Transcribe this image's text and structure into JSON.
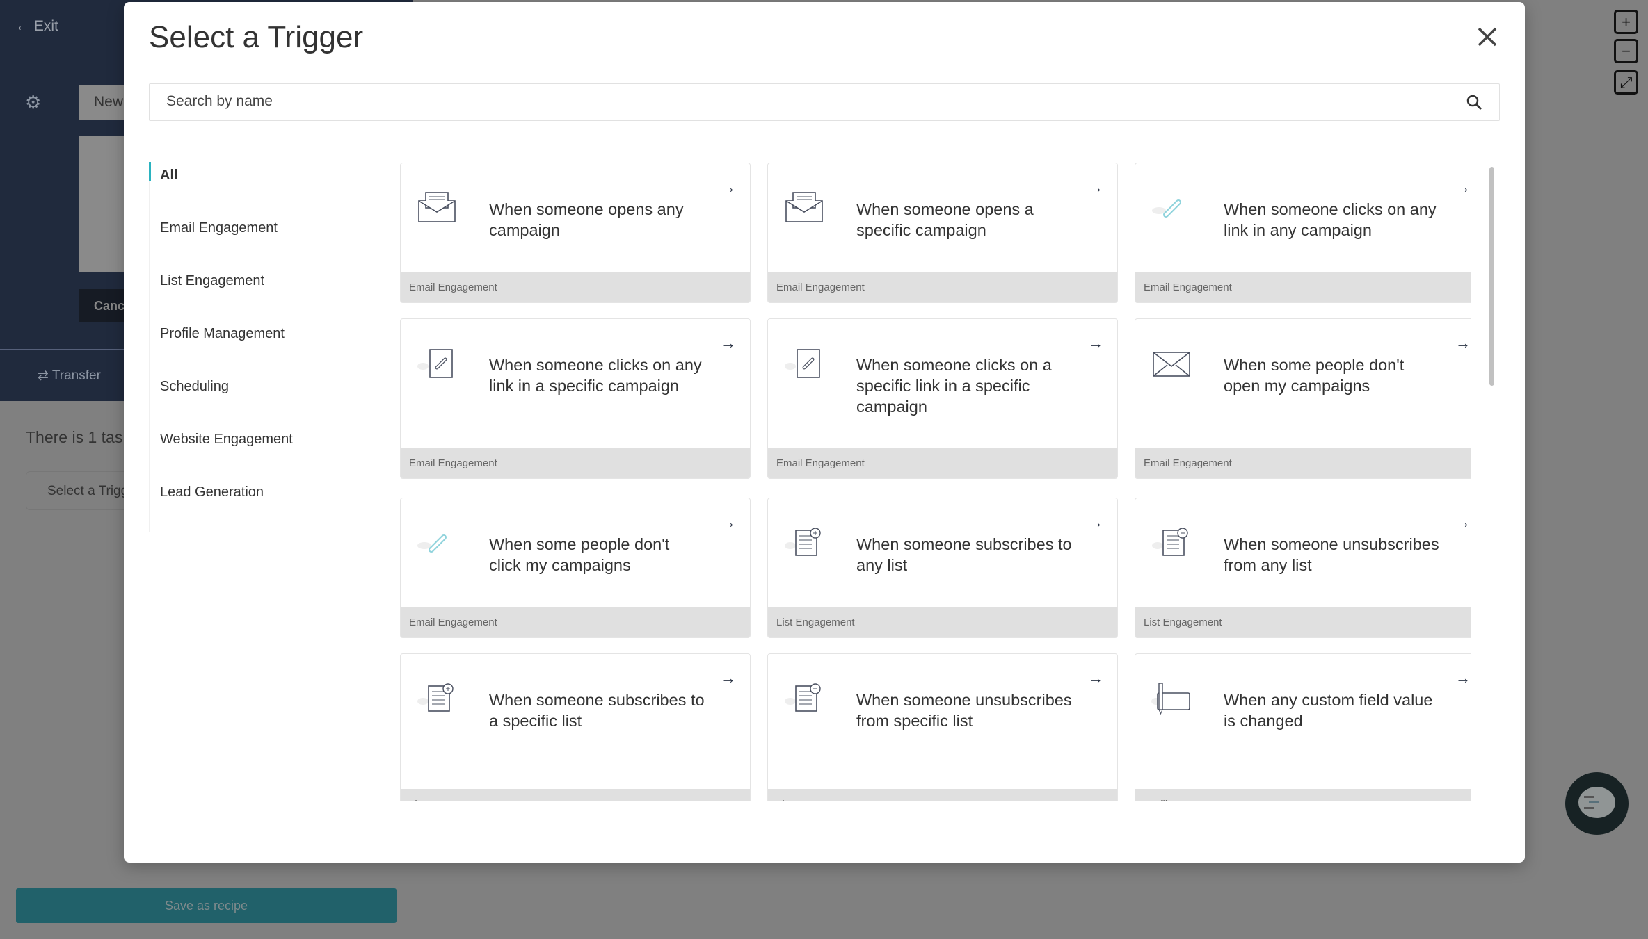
{
  "background": {
    "exit_label": "Exit",
    "name_field": "New",
    "cancel_label": "Cance",
    "transfer_label": "Transfer",
    "task_text": "There is 1 tas",
    "select_trigger_label": "Select a Trigg",
    "save_recipe_label": "Save as recipe",
    "zoom_in": "+",
    "zoom_out": "−",
    "fit": "⤢"
  },
  "modal": {
    "title": "Select a Trigger",
    "search_placeholder": "Search by name",
    "categories": [
      "All",
      "Email Engagement",
      "List Engagement",
      "Profile Management",
      "Scheduling",
      "Website Engagement",
      "Lead Generation"
    ],
    "active_category": "All",
    "cards": [
      {
        "title": "When someone opens any campaign",
        "category": "Email Engagement",
        "icon": "open-envelope-icon"
      },
      {
        "title": "When someone opens a specific campaign",
        "category": "Email Engagement",
        "icon": "open-envelope-icon"
      },
      {
        "title": "When someone clicks on any link in any campaign",
        "category": "Email Engagement",
        "icon": "link-icon"
      },
      {
        "title": "When someone clicks on any link in a specific campaign",
        "category": "Email Engagement",
        "icon": "document-link-icon"
      },
      {
        "title": "When someone clicks on a specific link in a specific campaign",
        "category": "Email Engagement",
        "icon": "document-link-icon"
      },
      {
        "title": "When some people don't open my campaigns",
        "category": "Email Engagement",
        "icon": "closed-envelope-icon"
      },
      {
        "title": "When some people don't click my campaigns",
        "category": "Email Engagement",
        "icon": "link-icon"
      },
      {
        "title": "When someone subscribes to any list",
        "category": "List Engagement",
        "icon": "list-add-icon"
      },
      {
        "title": "When someone unsubscribes from any list",
        "category": "List Engagement",
        "icon": "list-remove-icon"
      },
      {
        "title": "When someone subscribes to a specific list",
        "category": "List Engagement",
        "icon": "list-add-icon"
      },
      {
        "title": "When someone unsubscribes from specific list",
        "category": "List Engagement",
        "icon": "list-remove-icon"
      },
      {
        "title": "When any custom field value is changed",
        "category": "Profile Management",
        "icon": "field-edit-icon"
      }
    ]
  },
  "colors": {
    "accent": "#2bb3c0",
    "save_button": "#21616a",
    "sidebar": "#202a3d"
  }
}
